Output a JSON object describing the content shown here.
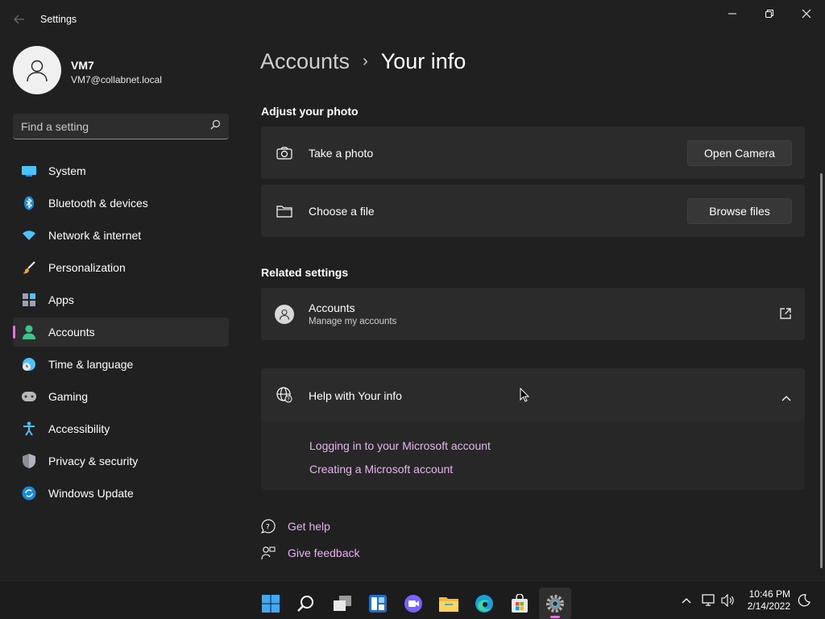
{
  "window": {
    "title": "Settings",
    "back_icon": "back-arrow-icon",
    "controls": [
      "minimize-icon",
      "restore-icon",
      "close-icon"
    ]
  },
  "profile": {
    "name": "VM7",
    "email": "VM7@collabnet.local",
    "avatar_icon": "person-icon"
  },
  "search": {
    "placeholder": "Find a setting",
    "icon": "search-icon"
  },
  "sidebar": {
    "items": [
      {
        "label": "System",
        "icon": "system-icon",
        "active": false
      },
      {
        "label": "Bluetooth & devices",
        "icon": "bluetooth-icon",
        "active": false
      },
      {
        "label": "Network & internet",
        "icon": "wifi-icon",
        "active": false
      },
      {
        "label": "Personalization",
        "icon": "brush-icon",
        "active": false
      },
      {
        "label": "Apps",
        "icon": "apps-icon",
        "active": false
      },
      {
        "label": "Accounts",
        "icon": "accounts-icon",
        "active": true
      },
      {
        "label": "Time & language",
        "icon": "clock-globe-icon",
        "active": false
      },
      {
        "label": "Gaming",
        "icon": "gamepad-icon",
        "active": false
      },
      {
        "label": "Accessibility",
        "icon": "accessibility-icon",
        "active": false
      },
      {
        "label": "Privacy & security",
        "icon": "shield-icon",
        "active": false
      },
      {
        "label": "Windows Update",
        "icon": "update-icon",
        "active": false
      }
    ]
  },
  "breadcrumb": {
    "parent": "Accounts",
    "separator": "›",
    "current": "Your info"
  },
  "adjust_photo": {
    "title": "Adjust your photo",
    "take_photo": {
      "label": "Take a photo",
      "button": "Open Camera",
      "icon": "camera-icon"
    },
    "choose_file": {
      "label": "Choose a file",
      "button": "Browse files",
      "icon": "folder-icon"
    }
  },
  "related": {
    "title": "Related settings",
    "accounts": {
      "label": "Accounts",
      "sublabel": "Manage my accounts",
      "icon": "person-icon",
      "action_icon": "open-external-icon"
    }
  },
  "help": {
    "title": "Help with Your info",
    "icon": "globe-icon",
    "chevron": "chevron-up-icon",
    "links": [
      "Logging in to your Microsoft account",
      "Creating a Microsoft account"
    ]
  },
  "footer": {
    "get_help": "Get help",
    "give_feedback": "Give feedback"
  },
  "taskbar": {
    "apps": [
      "start-icon",
      "search-icon",
      "task-view-icon",
      "widgets-icon",
      "chat-icon",
      "file-explorer-icon",
      "edge-icon",
      "store-icon",
      "settings-icon"
    ],
    "active_app": "settings-icon",
    "time": "10:46 PM",
    "date": "2/14/2022"
  },
  "colors": {
    "accent": "#d77bd3",
    "link": "#e6b5f0",
    "background": "#202020",
    "card": "#2b2b2b"
  }
}
